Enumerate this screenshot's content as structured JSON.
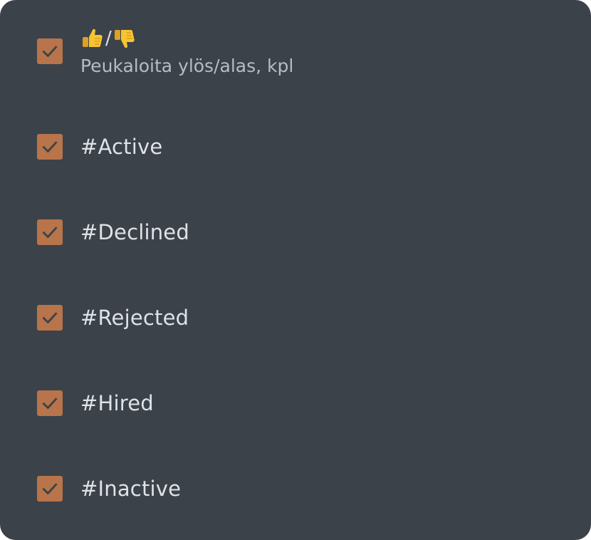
{
  "colors": {
    "panel_bg": "#3c424a",
    "checkbox_bg": "#b8744a",
    "checkmark": "#3c424a",
    "label_text": "#dfe2e6",
    "sublabel_text": "#b6bcc4"
  },
  "first_item": {
    "icons": [
      "thumbs-up-icon",
      "thumbs-down-icon"
    ],
    "separator": "/",
    "sublabel": "Peukaloita ylös/alas, kpl",
    "checked": true
  },
  "items": [
    {
      "label": "#Active",
      "checked": true
    },
    {
      "label": "#Declined",
      "checked": true
    },
    {
      "label": "#Rejected",
      "checked": true
    },
    {
      "label": "#Hired",
      "checked": true
    },
    {
      "label": "#Inactive",
      "checked": true
    }
  ]
}
